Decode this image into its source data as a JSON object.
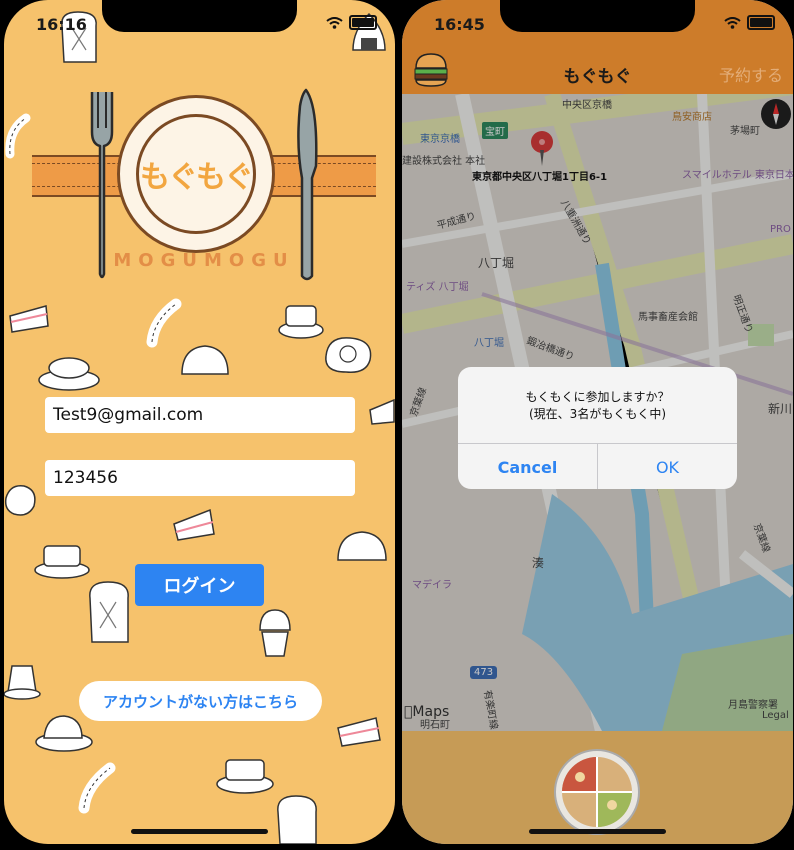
{
  "left": {
    "status_time": "16:16",
    "logo_text": "もぐもぐ",
    "logo_arc": "MOGUMOGU",
    "email": {
      "value": "Test9@gmail.com",
      "placeholder": ""
    },
    "password": {
      "value": "123456",
      "placeholder": ""
    },
    "login_label": "ログイン",
    "signup_label": "アカウントがない方はこちら"
  },
  "right": {
    "status_time": "16:45",
    "nav_title": "もぐもぐ",
    "nav_right": "予約する",
    "map_labels": {
      "l1": "東京京橋",
      "l2": "宝町",
      "l3": "鳥安商店",
      "l4": "茅場町",
      "l5": "建設株式会社 本社",
      "l6": "東京都中央区八丁堀1丁目6-1",
      "l7": "スマイルホテル 東京日本橋",
      "l8": "平成通り",
      "l9": "八重洲通り",
      "l10": "八丁堀",
      "l11": "ティズ 八丁堀",
      "l12": "PRO",
      "l13": "馬事畜産会館",
      "l14": "明正通り",
      "l15": "八丁堀",
      "l16": "鍛冶橋通り",
      "l17": "新川",
      "l18": "湊",
      "l19": "マデイラ",
      "l20": "京葉線",
      "l21": "473",
      "l22": "月島警察署",
      "l23": "Legal",
      "l24": "明石町",
      "l25": "有楽町線",
      "l26": "中央区京橋",
      "l27": "京葉線"
    },
    "maps_brand": "Maps",
    "alert_line1": "もくもくに参加しますか？",
    "alert_line2": "(現在、3名がもくもく中)",
    "cancel_label": "Cancel",
    "ok_label": "OK"
  },
  "colors": {
    "orange_bg": "#f6c26c",
    "nav_brown": "#cd7c2a",
    "accent_blue": "#2d84f2",
    "bottom_bar": "#c69b56"
  },
  "icons": [
    "wifi-icon",
    "battery-icon",
    "fork-icon",
    "knife-icon",
    "burger-icon",
    "compass-icon",
    "location-pin-icon",
    "pizza-icon"
  ]
}
